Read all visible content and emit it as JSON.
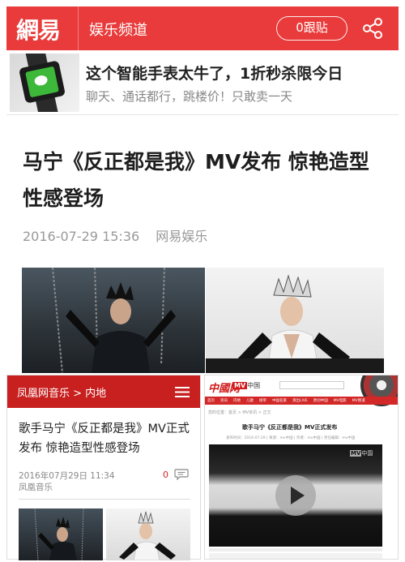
{
  "top_panel": {
    "header": {
      "logo": "網易",
      "channel": "娱乐频道",
      "follow_label": "0跟贴",
      "share_icon": "share-icon",
      "color": "#e93b3b"
    },
    "ad": {
      "title": "这个智能手表太牛了，1折秒杀限今日",
      "subtitle": "聊天、通话都行，跳楼价！只敢卖一天"
    },
    "article": {
      "title": "马宁《反正都是我》MV发布 惊艳造型性感登场",
      "date": "2016-07-29 15:36",
      "source": "网易娱乐"
    }
  },
  "ifeng": {
    "breadcrumb": "凤凰网音乐 > 内地",
    "menu_icon": "menu-icon",
    "title": "歌手马宁《反正都是我》MV正式发布 惊艳造型性感登场",
    "date": "2016年07月29日 11:34",
    "source": "凤凰音乐",
    "comment_count": "0",
    "color": "#c81f1f"
  },
  "mv_site": {
    "logo": "中國网",
    "brand_prefix": "MV",
    "brand_suffix": "中国",
    "nav": [
      "首页",
      "资讯",
      "内地",
      "儿歌",
      "榜单",
      "中国名家",
      "演出LIVE",
      "原创中国",
      "MV电影",
      "MV频道"
    ],
    "breadcrumb": "您的位置：首页 > MV资讯 > 正文",
    "title": "歌手马宁《反正都是我》MV正式发布",
    "meta": "发布时间：2016-07-29 | 来源：mv中国 | 作者：mv中国 | 责任编辑：mv中国",
    "watermark_prefix": "MV",
    "watermark_suffix": "中国",
    "color": "#d22828"
  }
}
